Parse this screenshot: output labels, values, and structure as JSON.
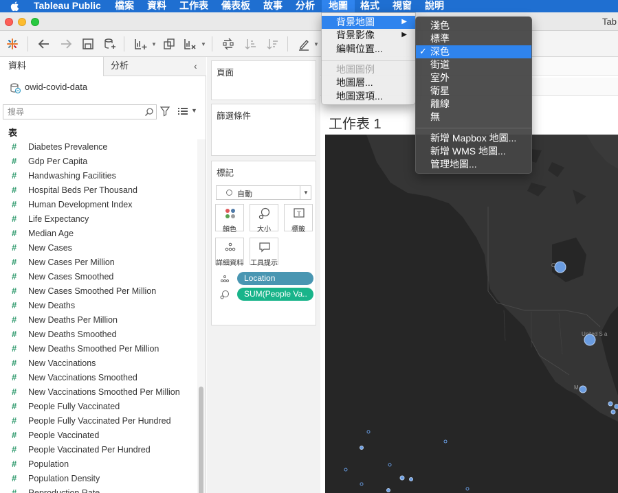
{
  "menubar": {
    "app_name": "Tableau Public",
    "items": [
      "檔案",
      "資料",
      "工作表",
      "儀表板",
      "故事",
      "分析",
      "地圖",
      "格式",
      "視窗",
      "說明"
    ]
  },
  "window": {
    "title": "Tab"
  },
  "left_pane": {
    "tab_data": "資料",
    "tab_analysis": "分析",
    "datasource": "owid-covid-data",
    "search_placeholder": "搜尋",
    "tables_header": "表",
    "fields": [
      "Diabetes Prevalence",
      "Gdp Per Capita",
      "Handwashing Facilities",
      "Hospital Beds Per Thousand",
      "Human Development Index",
      "Life Expectancy",
      "Median Age",
      "New Cases",
      "New Cases Per Million",
      "New Cases Smoothed",
      "New Cases Smoothed Per Million",
      "New Deaths",
      "New Deaths Per Million",
      "New Deaths Smoothed",
      "New Deaths Smoothed Per Million",
      "New Vaccinations",
      "New Vaccinations Smoothed",
      "New Vaccinations Smoothed Per Million",
      "People Fully Vaccinated",
      "People Fully Vaccinated Per Hundred",
      "People Vaccinated",
      "People Vaccinated Per Hundred",
      "Population",
      "Population Density",
      "Reproduction Rate"
    ]
  },
  "shelves": {
    "pages_title": "頁面",
    "filters_title": "篩選條件",
    "marks_title": "標記",
    "mark_type": "自動",
    "mark_buttons": [
      "顏色",
      "大小",
      "標籤",
      "詳細資料",
      "工具提示"
    ],
    "pills": [
      "Location",
      "SUM(People Va.."
    ],
    "pill_colors": [
      "#4996b2",
      "#19b48a"
    ]
  },
  "sheet": {
    "title": "工作表 1"
  },
  "map_menu": {
    "items": [
      "背景地圖",
      "背景影像",
      "編輯位置...",
      "地圖圖例",
      "地圖層...",
      "地圖選項..."
    ]
  },
  "background_map_submenu": {
    "items": [
      "淺色",
      "標準",
      "深色",
      "街道",
      "室外",
      "衛星",
      "離線",
      "無",
      "新增 Mapbox 地圖...",
      "新增 WMS 地圖...",
      "管理地圖..."
    ],
    "checked": "深色"
  },
  "map_labels": [
    "Ca  a",
    "United S  a",
    "M  co"
  ],
  "colors": {
    "menubar": "#1f6fd1",
    "menu_highlight": "#2f84ee",
    "map_bg": "#262626",
    "mark": "#6a9ce0"
  }
}
